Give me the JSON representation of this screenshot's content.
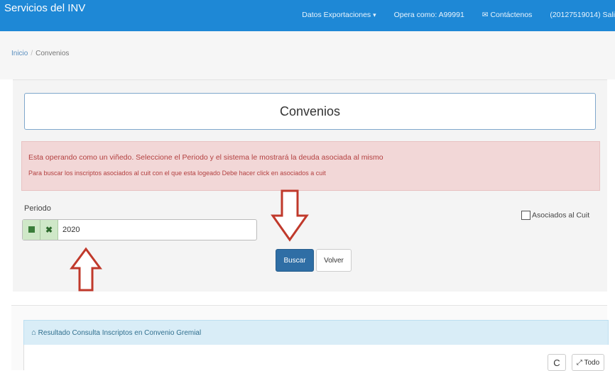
{
  "navbar": {
    "brand": "Servicios del INV",
    "menu_datos": "Datos Exportaciones",
    "menu_datos_caret": "▾",
    "opera_como": "Opera como: A99991",
    "contact_icon": "envelope-icon",
    "contact": "Contáctenos",
    "user": "(20127519014) Sali"
  },
  "breadcrumb": {
    "home": "Inicio",
    "separator": "/",
    "current": "Convenios"
  },
  "page": {
    "title": "Convenios"
  },
  "alert": {
    "line1": "Esta operando como un viñedo. Seleccione el Periodo y el sistema le mostrará la deuda asociada al mismo",
    "line2": "Para buscar los inscriptos asociados al cuit con el que esta logeado Debe hacer click en asociados a cuit"
  },
  "form": {
    "periodo_label": "Periodo",
    "periodo_value": "2020",
    "clear_glyph": "✖",
    "asociados_label": "Asociados al Cuit",
    "buscar_label": "Buscar",
    "volver_label": "Volver"
  },
  "result_panel": {
    "title": "Resultado Consulta Inscriptos en Convenio Gremial",
    "home_glyph": "🏠",
    "refresh_glyph": "C",
    "todo_glyph": "⤢",
    "todo_label": "Todo"
  },
  "colors": {
    "navbar_bg": "#1e88d6",
    "alert_bg": "#f2d7d7",
    "alert_text": "#b34040",
    "primary_button": "#2f6ea5",
    "annotation_arrow": "#c0392b",
    "panel_heading_bg": "#d9edf7"
  }
}
